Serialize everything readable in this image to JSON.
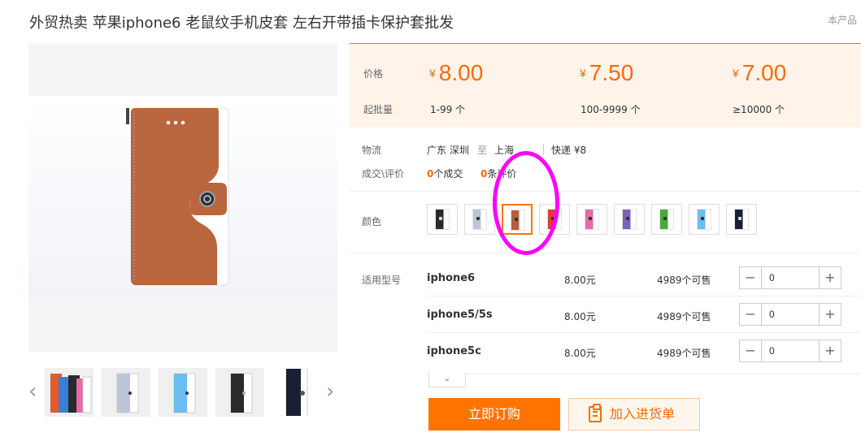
{
  "product": {
    "title": "外贸热卖 苹果iphone6 老鼠纹手机皮套 左右开带插卡保护套批发",
    "top_right_text": "本产品"
  },
  "price_panel": {
    "price_label": "价格",
    "moq_label": "起批量",
    "currency": "¥",
    "tiers": [
      {
        "price": "8.00",
        "range": "1-99 个"
      },
      {
        "price": "7.50",
        "range": "100-9999 个"
      },
      {
        "price": "7.00",
        "range": "≥10000 个"
      }
    ]
  },
  "logistics": {
    "label": "物流",
    "from": "广东 深圳",
    "to_word": "至",
    "to": "上海",
    "express": "快递 ¥8"
  },
  "deals": {
    "label": "成交\\评价",
    "deals_count": "0",
    "deals_text": "个成交",
    "reviews_count": "0",
    "reviews_text": "条评价"
  },
  "color": {
    "label": "颜色",
    "selected_index": 2,
    "swatches": [
      {
        "name": "swatch-black-white",
        "main": "#2a2a2a",
        "accent": "#ffffff"
      },
      {
        "name": "swatch-light-blue-grey",
        "main": "#bcc6d6",
        "accent": "#ffffff"
      },
      {
        "name": "swatch-brown",
        "main": "#b5603a",
        "accent": "#ffffff"
      },
      {
        "name": "swatch-red",
        "main": "#e63a3a",
        "accent": "#ffffff"
      },
      {
        "name": "swatch-pink",
        "main": "#e86aa8",
        "accent": "#ffffff"
      },
      {
        "name": "swatch-purple",
        "main": "#7a62b8",
        "accent": "#ffffff"
      },
      {
        "name": "swatch-green",
        "main": "#4aa83c",
        "accent": "#ffffff"
      },
      {
        "name": "swatch-sky-blue",
        "main": "#6cbcef",
        "accent": "#ffffff"
      },
      {
        "name": "swatch-navy",
        "main": "#1a1f33",
        "accent": "#ffffff"
      }
    ]
  },
  "models": {
    "label": "适用型号",
    "items": [
      {
        "name": "iphone6",
        "price": "8.00元",
        "stock": "4989个可售",
        "qty": "0"
      },
      {
        "name": "iphone5/5s",
        "price": "8.00元",
        "stock": "4989个可售",
        "qty": "0"
      },
      {
        "name": "iphone5c",
        "price": "8.00元",
        "stock": "4989个可售",
        "qty": "0"
      }
    ],
    "minus": "−",
    "plus": "+"
  },
  "actions": {
    "buy_label": "立即订购",
    "cart_label": "加入进货单"
  },
  "thumbnails": [
    {
      "name": "thumb-multicolor",
      "main": "#3b7fd0",
      "accent": "#e35a2b"
    },
    {
      "name": "thumb-grey-blue",
      "main": "#bcc6d6",
      "accent": "#ffffff"
    },
    {
      "name": "thumb-sky-blue",
      "main": "#6cbcef",
      "accent": "#ffffff"
    },
    {
      "name": "thumb-black",
      "main": "#2a2a2a",
      "accent": "#ffffff"
    },
    {
      "name": "thumb-navy",
      "main": "#1a1f33",
      "accent": "#ffffff"
    }
  ],
  "icons": {
    "prev": "‹",
    "next": "›",
    "dropdown": "⌄",
    "expand": "⌄"
  },
  "colors": {
    "accent": "#ff7300",
    "price": "#ff6a00",
    "panel_bg": "#fff3ea",
    "highlight_circle": "#ff00ff"
  }
}
